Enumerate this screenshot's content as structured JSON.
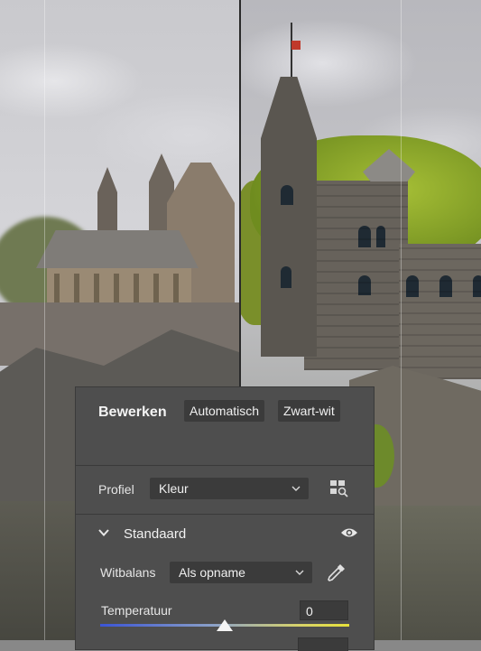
{
  "panel": {
    "title": "Bewerken",
    "auto_button": "Automatisch",
    "bw_button": "Zwart-wit",
    "profile_label": "Profiel",
    "profile_value": "Kleur",
    "section_title": "Standaard",
    "whitebalance_label": "Witbalans",
    "whitebalance_value": "Als opname",
    "temperature_label": "Temperatuur",
    "temperature_value": "0",
    "temperature_slider_fraction": 0.5
  },
  "icons": {
    "profile_browser": "profile-browser-icon",
    "visibility": "eye-icon",
    "eyedropper": "eyedropper-icon",
    "dropdown": "chevron-down-icon",
    "section_toggle": "chevron-down-icon"
  },
  "colors": {
    "panel_bg": "#4e4e4e",
    "control_bg": "#3b3b3b",
    "slider_cool": "#3b55d6",
    "slider_warm": "#e6e13a"
  }
}
